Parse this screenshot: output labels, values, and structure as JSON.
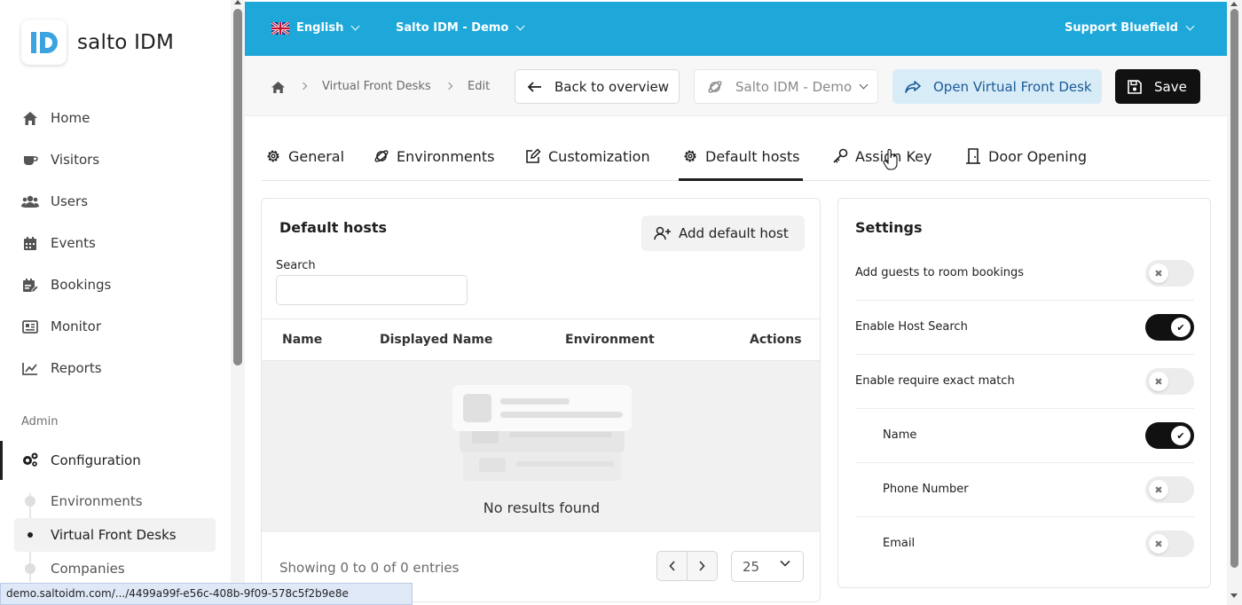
{
  "app": {
    "name": "salto IDM",
    "logo_letters": "ID"
  },
  "sidebar": {
    "items": [
      {
        "label": "Home",
        "icon": "home-icon"
      },
      {
        "label": "Visitors",
        "icon": "coffee-cup-icon"
      },
      {
        "label": "Users",
        "icon": "users-icon"
      },
      {
        "label": "Events",
        "icon": "calendar-icon"
      },
      {
        "label": "Bookings",
        "icon": "calendar-edit-icon"
      },
      {
        "label": "Monitor",
        "icon": "monitor-icon"
      },
      {
        "label": "Reports",
        "icon": "chart-icon"
      }
    ],
    "admin_label": "Admin",
    "configuration_label": "Configuration",
    "sub_items": [
      {
        "label": "Environments"
      },
      {
        "label": "Virtual Front Desks"
      },
      {
        "label": "Companies"
      }
    ]
  },
  "topbar": {
    "language": "English",
    "environment": "Salto IDM - Demo",
    "user": "Support Bluefield",
    "bg_color": "#1ea8d9"
  },
  "toolbar": {
    "breadcrumb": [
      "Virtual Front Desks",
      "Edit"
    ],
    "back_label": "Back to overview",
    "env_select": "Salto IDM - Demo",
    "open_label": "Open Virtual Front Desk",
    "save_label": "Save"
  },
  "tabs": [
    {
      "label": "General",
      "icon": "gear-icon"
    },
    {
      "label": "Environments",
      "icon": "planet-icon"
    },
    {
      "label": "Customization",
      "icon": "edit-icon"
    },
    {
      "label": "Default hosts",
      "icon": "gear-icon"
    },
    {
      "label": "Assign Key",
      "icon": "key-icon"
    },
    {
      "label": "Door Opening",
      "icon": "door-icon"
    }
  ],
  "active_tab": "Default hosts",
  "hosts": {
    "title": "Default hosts",
    "add_label": "Add default host",
    "search_label": "Search",
    "search_value": "",
    "columns": [
      "Name",
      "Displayed Name",
      "Environment",
      "Actions"
    ],
    "empty_text": "No results found",
    "footer_text": "Showing 0 to 0 of 0 entries",
    "page_size": "25"
  },
  "settings": {
    "title": "Settings",
    "rows": [
      {
        "label": "Add guests to room bookings",
        "on": false,
        "indent": false
      },
      {
        "label": "Enable Host Search",
        "on": true,
        "indent": false
      },
      {
        "label": "Enable require exact match",
        "on": false,
        "indent": false
      },
      {
        "label": "Name",
        "on": true,
        "indent": true
      },
      {
        "label": "Phone Number",
        "on": false,
        "indent": true
      },
      {
        "label": "Email",
        "on": false,
        "indent": true
      }
    ]
  },
  "status_url": "demo.saltoidm.com/.../4499a99f-e56c-408b-9f09-578c5f2b9e8e"
}
